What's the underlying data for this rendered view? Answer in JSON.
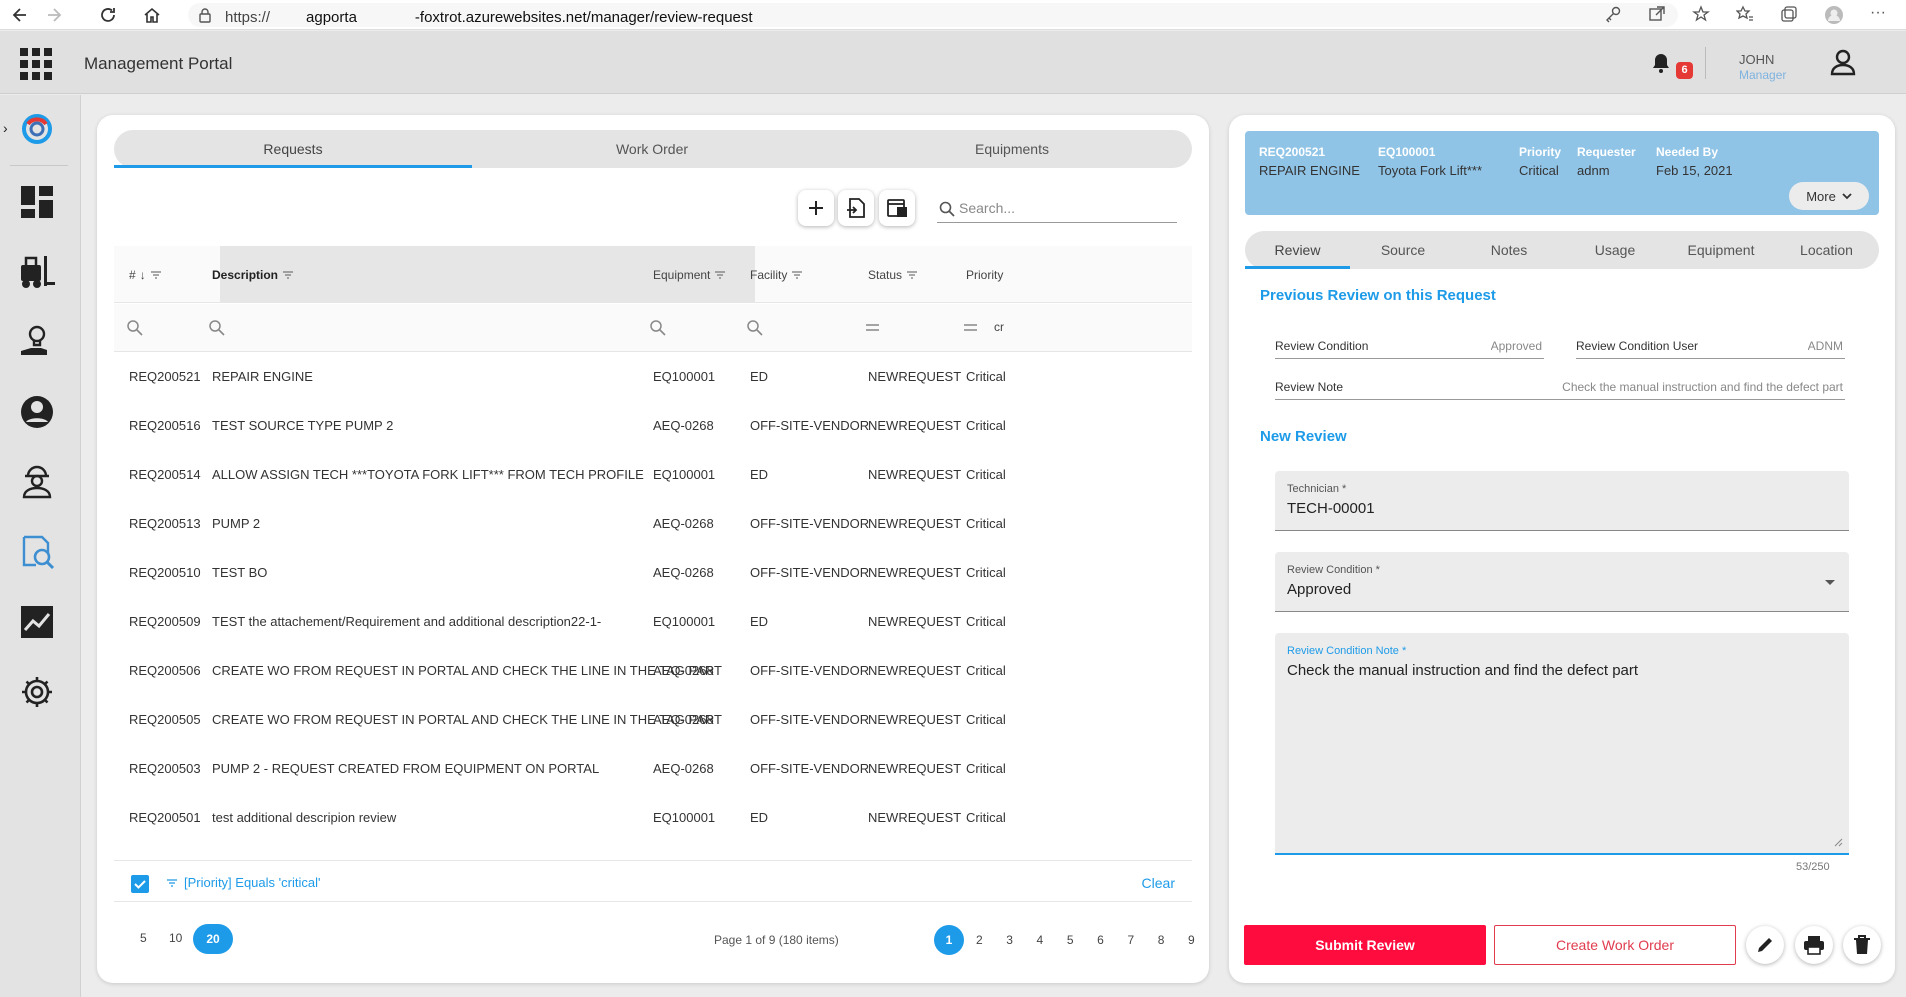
{
  "browser": {
    "url_prefix": "https://",
    "url_domain_part": "agporta",
    "url_suffix": "-foxtrot.azurewebsites.net/manager/review-request"
  },
  "header": {
    "app_title": "Management Portal",
    "notification_count": "6",
    "user_name": "JOHN",
    "user_role": "Manager"
  },
  "left": {
    "tabs": [
      "Requests",
      "Work Order",
      "Equipments"
    ],
    "active_tab": "Requests",
    "search_placeholder": "Search...",
    "columns": {
      "num": "#",
      "description": "Description",
      "equipment": "Equipment",
      "facility": "Facility",
      "status": "Status",
      "priority": "Priority"
    },
    "priority_filter_text": "cr",
    "rows": [
      {
        "id": "REQ200521",
        "description": "REPAIR ENGINE",
        "equipment": "EQ100001",
        "facility": "ED",
        "status": "NEWREQUEST",
        "priority": "Critical"
      },
      {
        "id": "REQ200516",
        "description": "TEST SOURCE TYPE PUMP 2",
        "equipment": "AEQ-0268",
        "facility": "OFF-SITE-VENDOR",
        "status": "NEWREQUEST",
        "priority": "Critical"
      },
      {
        "id": "REQ200514",
        "description": "ALLOW ASSIGN TECH ***TOYOTA FORK LIFT*** FROM TECH PROFILE",
        "equipment": "EQ100001",
        "facility": "ED",
        "status": "NEWREQUEST",
        "priority": "Critical"
      },
      {
        "id": "REQ200513",
        "description": "PUMP 2",
        "equipment": "AEQ-0268",
        "facility": "OFF-SITE-VENDOR",
        "status": "NEWREQUEST",
        "priority": "Critical"
      },
      {
        "id": "REQ200510",
        "description": "TEST BO",
        "equipment": "AEQ-0268",
        "facility": "OFF-SITE-VENDOR",
        "status": "NEWREQUEST",
        "priority": "Critical"
      },
      {
        "id": "REQ200509",
        "description": "TEST the attachement/Requirement and additional description22-1-",
        "equipment": "EQ100001",
        "facility": "ED",
        "status": "NEWREQUEST",
        "priority": "Critical"
      },
      {
        "id": "REQ200506",
        "description": "CREATE WO FROM REQUEST IN PORTAL AND CHECK THE LINE IN THE TAG PART",
        "equipment": "AEQ-0268",
        "facility": "OFF-SITE-VENDOR",
        "status": "NEWREQUEST",
        "priority": "Critical"
      },
      {
        "id": "REQ200505",
        "description": "CREATE WO FROM REQUEST IN PORTAL AND CHECK THE LINE IN THE TAG PART",
        "equipment": "AEQ-0268",
        "facility": "OFF-SITE-VENDOR",
        "status": "NEWREQUEST",
        "priority": "Critical"
      },
      {
        "id": "REQ200503",
        "description": "PUMP 2 - REQUEST CREATED FROM EQUIPMENT ON PORTAL",
        "equipment": "AEQ-0268",
        "facility": "OFF-SITE-VENDOR",
        "status": "NEWREQUEST",
        "priority": "Critical"
      },
      {
        "id": "REQ200501",
        "description": "test additional descripion review",
        "equipment": "EQ100001",
        "facility": "ED",
        "status": "NEWREQUEST",
        "priority": "Critical"
      }
    ],
    "active_filter": "[Priority] Equals 'critical'",
    "clear_label": "Clear",
    "page_sizes": [
      "5",
      "10",
      "20"
    ],
    "active_page_size": "20",
    "page_info": "Page 1 of 9 (180 items)",
    "pages": [
      "1",
      "2",
      "3",
      "4",
      "5",
      "6",
      "7",
      "8",
      "9"
    ],
    "active_page": "1"
  },
  "right": {
    "header": {
      "req_id": "REQ200521",
      "req_desc": "REPAIR ENGINE",
      "eq_id": "EQ100001",
      "eq_name": "Toyota Fork Lift***",
      "priority_label": "Priority",
      "priority_value": "Critical",
      "requester_label": "Requester",
      "requester_value": "adnm",
      "needed_label": "Needed By",
      "needed_value": "Feb 15, 2021",
      "more_label": "More"
    },
    "tabs": [
      "Review",
      "Source",
      "Notes",
      "Usage",
      "Equipment",
      "Location"
    ],
    "active_tab": "Review",
    "prev_title": "Previous Review on this Request",
    "prev_condition_label": "Review Condition",
    "prev_condition_value": "Approved",
    "prev_user_label": "Review Condition User",
    "prev_user_value": "ADNM",
    "prev_note_label": "Review Note",
    "prev_note_value": "Check the manual instruction and find the defect part",
    "new_title": "New Review",
    "technician_label": "Technician *",
    "technician_value": "TECH-00001",
    "condition_label": "Review Condition *",
    "condition_value": "Approved",
    "note_label": "Review Condition Note *",
    "note_value": "Check the manual instruction and find the defect part",
    "note_counter": "53/250",
    "submit_label": "Submit Review",
    "create_wo_label": "Create Work Order"
  },
  "colors": {
    "accent": "#1e9be8",
    "danger": "#ff0c3e",
    "header_card": "#90c4e7"
  }
}
